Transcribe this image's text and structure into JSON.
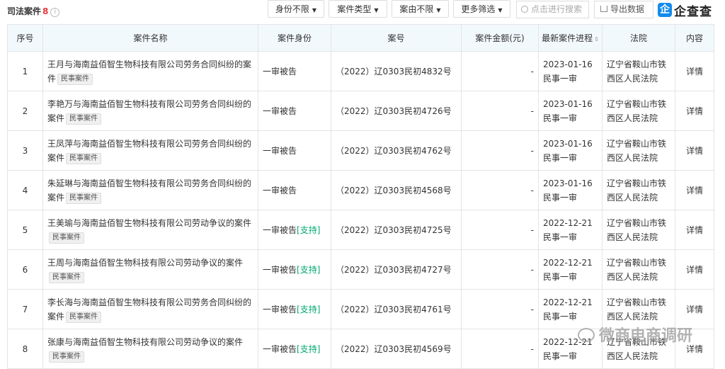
{
  "header": {
    "title": "司法案件",
    "count": "8",
    "info_icon": "i"
  },
  "filters": [
    {
      "label": "身份不限"
    },
    {
      "label": "案件类型"
    },
    {
      "label": "案由不限"
    },
    {
      "label": "更多筛选"
    }
  ],
  "search": {
    "placeholder": "点击进行搜索"
  },
  "export": {
    "label": "导出数据"
  },
  "brand": {
    "logo": "企",
    "name": "企查查",
    "color": "#128bed"
  },
  "table": {
    "columns": [
      "序号",
      "案件名称",
      "案件身份",
      "案号",
      "案件金额(元)",
      "最新案件进程",
      "法院",
      "内容"
    ],
    "rows": [
      {
        "idx": "1",
        "name": "王月与海南益佰智生物科技有限公司劳务合同纠纷的案件",
        "tag": "民事案件",
        "role": "一审被告",
        "support": "",
        "case_no": "（2022）辽0303民初4832号",
        "amount": "-",
        "date": "2023-01-16",
        "stage": "民事一审",
        "court": "辽宁省鞍山市铁西区人民法院",
        "detail": "详情"
      },
      {
        "idx": "2",
        "name": "李艳万与海南益佰智生物科技有限公司劳务合同纠纷的案件",
        "tag": "民事案件",
        "role": "一审被告",
        "support": "",
        "case_no": "（2022）辽0303民初4726号",
        "amount": "-",
        "date": "2023-01-16",
        "stage": "民事一审",
        "court": "辽宁省鞍山市铁西区人民法院",
        "detail": "详情"
      },
      {
        "idx": "3",
        "name": "王凤萍与海南益佰智生物科技有限公司劳务合同纠纷的案件",
        "tag": "民事案件",
        "role": "一审被告",
        "support": "",
        "case_no": "（2022）辽0303民初4762号",
        "amount": "-",
        "date": "2023-01-16",
        "stage": "民事一审",
        "court": "辽宁省鞍山市铁西区人民法院",
        "detail": "详情"
      },
      {
        "idx": "4",
        "name": "朱延琳与海南益佰智生物科技有限公司劳务合同纠纷的案件",
        "tag": "民事案件",
        "role": "一审被告",
        "support": "",
        "case_no": "（2022）辽0303民初4568号",
        "amount": "-",
        "date": "2023-01-16",
        "stage": "民事一审",
        "court": "辽宁省鞍山市铁西区人民法院",
        "detail": "详情"
      },
      {
        "idx": "5",
        "name": "王美瑜与海南益佰智生物科技有限公司劳动争议的案件",
        "tag": "民事案件",
        "role": "一审被告",
        "support": "[支持]",
        "case_no": "（2022）辽0303民初4725号",
        "amount": "-",
        "date": "2022-12-21",
        "stage": "民事一审",
        "court": "辽宁省鞍山市铁西区人民法院",
        "detail": "详情"
      },
      {
        "idx": "6",
        "name": "王周与海南益佰智生物科技有限公司劳动争议的案件",
        "tag": "民事案件",
        "role": "一审被告",
        "support": "[支持]",
        "case_no": "（2022）辽0303民初4727号",
        "amount": "-",
        "date": "2022-12-21",
        "stage": "民事一审",
        "court": "辽宁省鞍山市铁西区人民法院",
        "detail": "详情"
      },
      {
        "idx": "7",
        "name": "李长海与海南益佰智生物科技有限公司劳务合同纠纷的案件",
        "tag": "民事案件",
        "role": "一审被告",
        "support": "[支持]",
        "case_no": "（2022）辽0303民初4761号",
        "amount": "-",
        "date": "2022-12-21",
        "stage": "民事一审",
        "court": "辽宁省鞍山市铁西区人民法院",
        "detail": "详情"
      },
      {
        "idx": "8",
        "name": "张康与海南益佰智生物科技有限公司劳动争议的案件",
        "tag": "民事案件",
        "role": "一审被告",
        "support": "[支持]",
        "case_no": "（2022）辽0303民初4569号",
        "amount": "-",
        "date": "2022-12-21",
        "stage": "民事一审",
        "court": "辽宁省鞍山市铁西区人民法院",
        "detail": "详情"
      }
    ]
  },
  "watermark": {
    "text": "微商电商调研"
  },
  "colors": {
    "link": "#128bed",
    "support": "#00a870",
    "count": "#e4393c",
    "header_bg": "#f2f9fc"
  }
}
